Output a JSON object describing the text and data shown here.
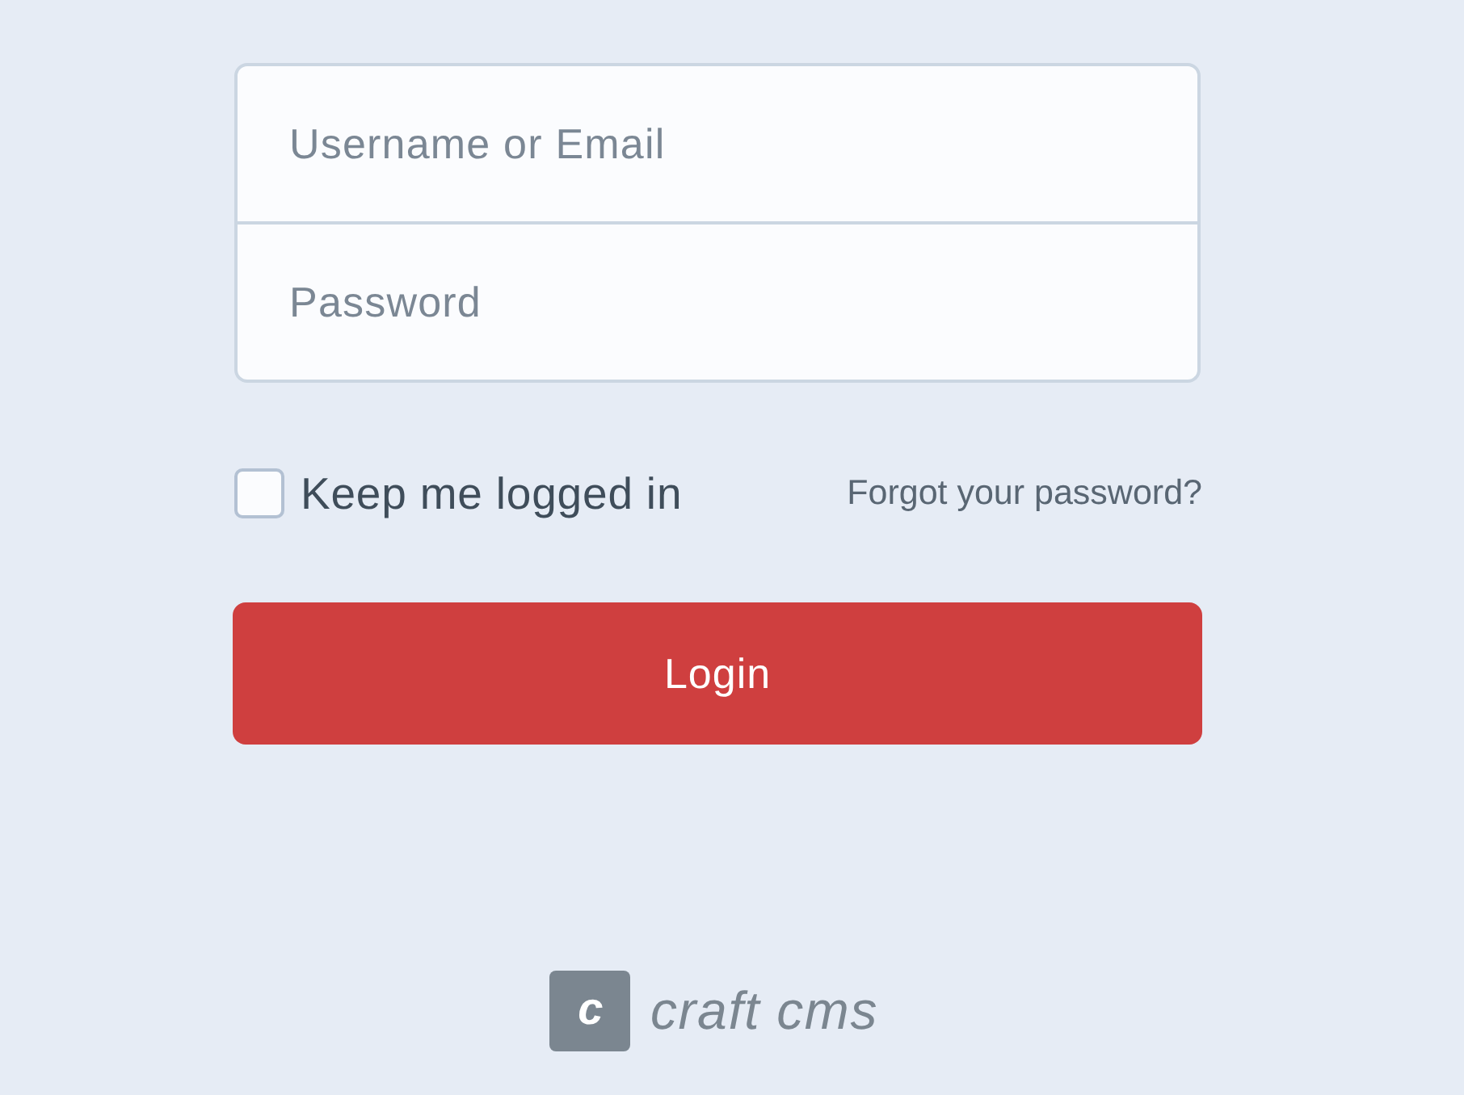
{
  "login_form": {
    "username_field": {
      "placeholder": "Username or Email"
    },
    "password_field": {
      "placeholder": "Password"
    }
  },
  "remember_me": {
    "label": "Keep me logged in",
    "checked": false
  },
  "forgot_password_link": "Forgot your password?",
  "login_button": "Login",
  "footer_logo": {
    "mark": "c",
    "wordmark": "craft cms"
  }
}
